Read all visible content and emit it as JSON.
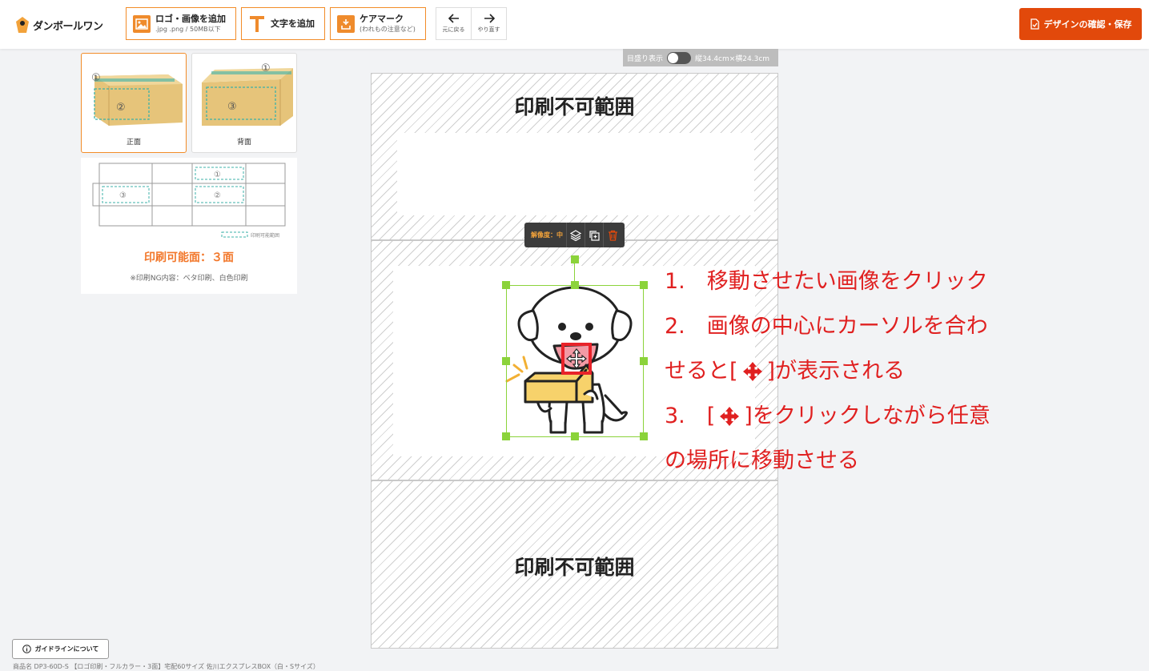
{
  "header": {
    "logo_text": "ダンボールワン",
    "add_image": {
      "title": "ロゴ・画像を追加",
      "sub": ".jpg .png / 50MB以下"
    },
    "add_text": {
      "title": "文字を追加"
    },
    "care_mark": {
      "title": "ケアマーク",
      "sub": "(われもの注意など)"
    },
    "undo_label": "元に戻る",
    "redo_label": "やり直す",
    "save_label": "デザインの確認・保存"
  },
  "faces": [
    {
      "label": "正面",
      "marks": [
        "①",
        "②"
      ],
      "active": true
    },
    {
      "label": "背面",
      "marks": [
        "①",
        "③"
      ],
      "active": false
    }
  ],
  "net": {
    "marks": [
      "①",
      "③",
      "②"
    ],
    "legend": "印刷可能範囲",
    "heading": "印刷可能面：３面",
    "note": "※印刷NG内容：ベタ印刷、白色印刷"
  },
  "canvas": {
    "bleed_label": "目盛り表示",
    "size_label": "縦34.4cm×横24.3cm",
    "unprintable_label": "印刷不可範囲",
    "resolution_label": "解像度：中"
  },
  "instructions": [
    "1.　移動させたい画像をクリック",
    "2.　画像の中心にカーソルを合わ",
    "せると[",
    "]が表示される",
    "3.　[",
    "]をクリックしながら任意",
    "の場所に移動させる"
  ],
  "footer": {
    "guide_label": "ガイドラインについて",
    "product_name": "商品名 DP3-60D-S 【ロゴ印刷・フルカラー・3面】宅配60サイズ 佐川エクスプレスBOX（白・Sサイズ）"
  }
}
